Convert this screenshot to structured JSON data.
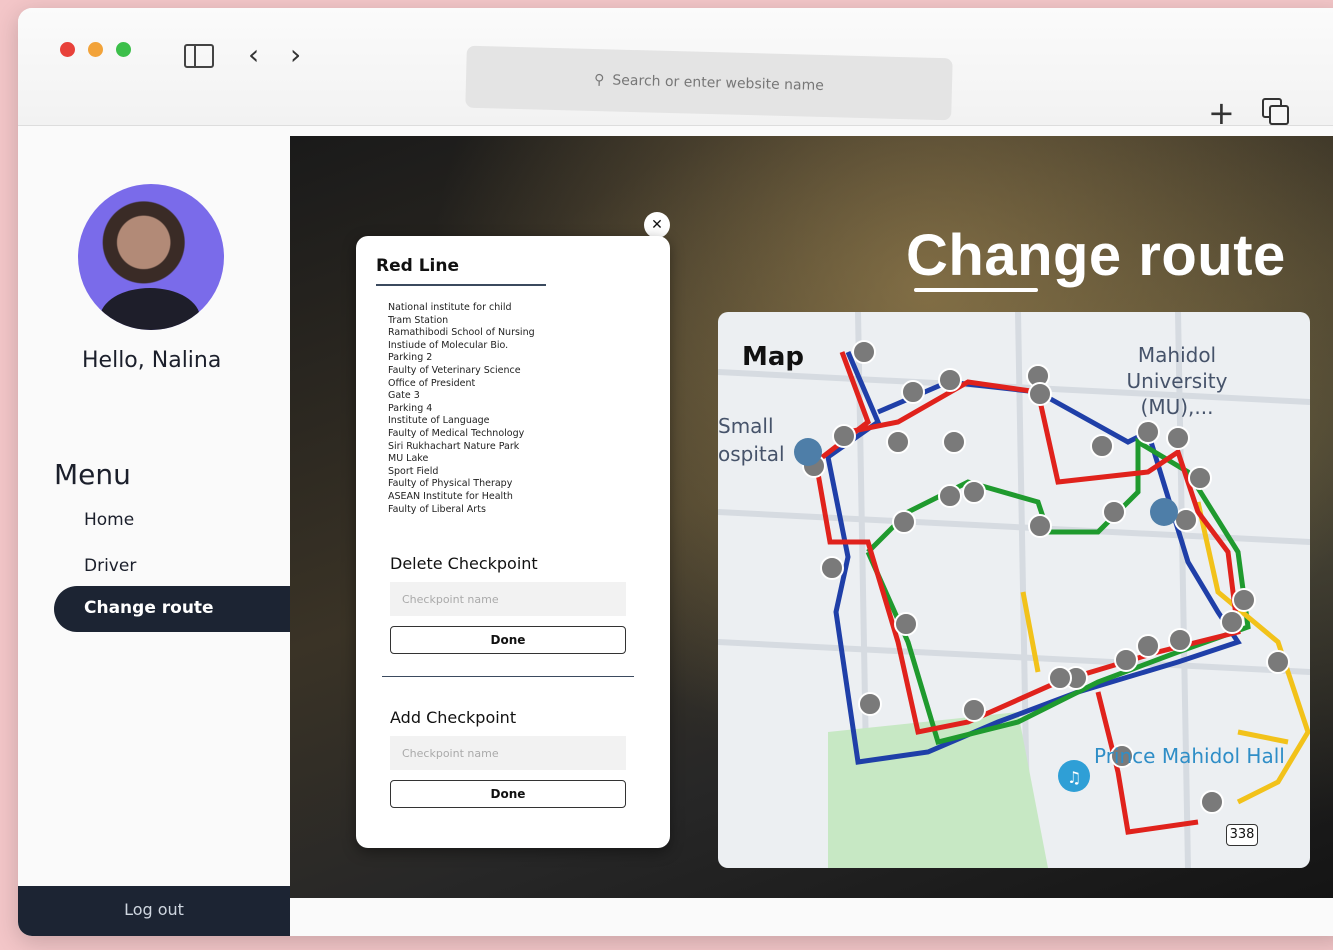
{
  "browser": {
    "address_placeholder": "Search or enter website name",
    "icons": [
      "sidebar-icon",
      "back-icon",
      "forward-icon",
      "search-icon",
      "new-tab-icon",
      "tabs-icon"
    ]
  },
  "sidebar": {
    "greeting": "Hello, Nalina",
    "menu_title": "Menu",
    "items": [
      {
        "label": "Home"
      },
      {
        "label": "Driver"
      },
      {
        "label": "Change route"
      }
    ],
    "logout_label": "Log out",
    "accent_color": "#1c2433"
  },
  "page": {
    "title": "Change route"
  },
  "route_panel": {
    "line_name": "Red Line",
    "checkpoints": [
      "National institute for child",
      "Tram Station",
      "Ramathibodi School of Nursing",
      "Instiude of Molecular Bio.",
      "Parking 2",
      "Faulty of Veterinary Science",
      "Office of President",
      "Gate 3",
      "Parking 4",
      "Institute of Language",
      "Faulty of Medical Technology",
      "Siri Rukhachart Nature Park",
      "MU Lake",
      "Sport Field",
      "Faulty of Physical Therapy",
      "ASEAN Institute for Health",
      "Faulty of Liberal Arts"
    ],
    "delete": {
      "title": "Delete Checkpoint",
      "placeholder": "Checkpoint name",
      "button": "Done"
    },
    "add": {
      "title": "Add Checkpoint",
      "placeholder": "Checkpoint name",
      "button": "Done"
    }
  },
  "map": {
    "label": "Map",
    "poi_mahidol": "Mahidol University (MU),...",
    "poi_hospital": "Small ospital",
    "poi_hall": "Prince Mahidol Hall",
    "road_number": "338",
    "route_colors": {
      "red": "#e0221c",
      "blue": "#1f3fa8",
      "green": "#1f9a2e",
      "yellow": "#f2c21a"
    }
  }
}
